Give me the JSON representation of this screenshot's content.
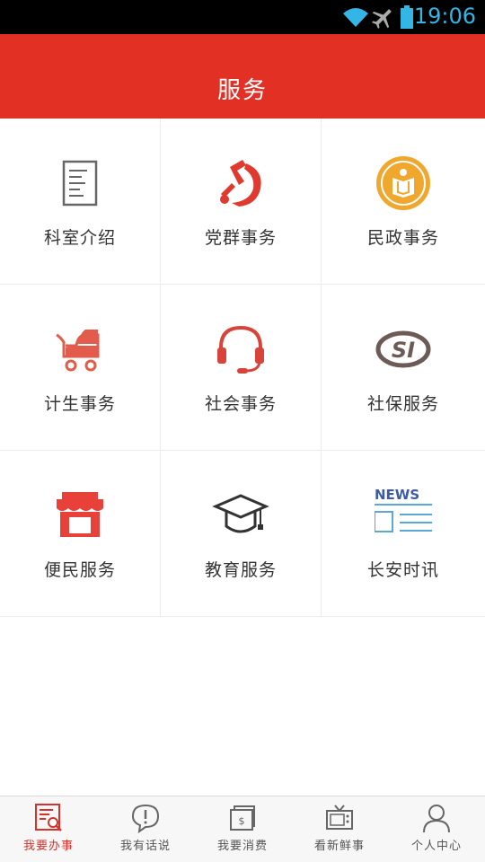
{
  "status_bar": {
    "time": "19:06",
    "accent": "#33b5e5"
  },
  "header": {
    "title": "服务",
    "color": "#e33025"
  },
  "services": [
    {
      "label": "科室介绍",
      "icon": "document-icon"
    },
    {
      "label": "党群事务",
      "icon": "party-emblem-icon"
    },
    {
      "label": "民政事务",
      "icon": "civil-affairs-emblem-icon"
    },
    {
      "label": "计生事务",
      "icon": "baby-stroller-icon"
    },
    {
      "label": "社会事务",
      "icon": "headset-icon"
    },
    {
      "label": "社保服务",
      "icon": "social-security-logo-icon"
    },
    {
      "label": "便民服务",
      "icon": "storefront-icon"
    },
    {
      "label": "教育服务",
      "icon": "graduation-cap-icon"
    },
    {
      "label": "长安时讯",
      "icon": "news-icon"
    }
  ],
  "news_icon_text": "NEWS",
  "social_security_icon_text": "SI",
  "tabs": [
    {
      "label": "我要办事",
      "icon": "search-document-icon",
      "active": true
    },
    {
      "label": "我有话说",
      "icon": "speech-bubble-icon",
      "active": false
    },
    {
      "label": "我要消费",
      "icon": "wallet-icon",
      "active": false
    },
    {
      "label": "看新鲜事",
      "icon": "tv-icon",
      "active": false
    },
    {
      "label": "个人中心",
      "icon": "person-icon",
      "active": false
    }
  ],
  "active_tab_color": "#d8312a"
}
